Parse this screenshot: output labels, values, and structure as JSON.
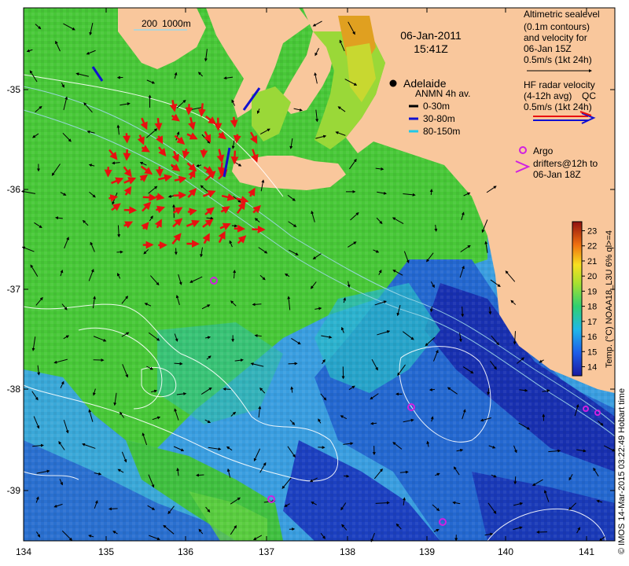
{
  "header": {
    "date": "06-Jan-2011",
    "time": "15:41Z"
  },
  "scale_bar": {
    "label_a": "200",
    "label_b": "1000m"
  },
  "places": {
    "adelaide": "Adelaide"
  },
  "legend_altimetry": {
    "line1": "Altimetric sealevel",
    "line2": "(0.1m contours)",
    "line3": "and velocity for",
    "line4": "06-Jan 15Z",
    "line5": "0.5m/s (1kt 24h)"
  },
  "legend_hf": {
    "line1": "HF radar velocity",
    "line2": "(4-12h avg)",
    "line2_tail": "QC",
    "line3": "0.5m/s (1kt 24h)"
  },
  "legend_anmn": {
    "title": "ANMN 4h av.",
    "entries": [
      {
        "label": "0-30m",
        "color": "#000000"
      },
      {
        "label": "30-80m",
        "color": "#1010d0"
      },
      {
        "label": "80-150m",
        "color": "#20c8e8"
      }
    ]
  },
  "legend_argo": {
    "line1": "Argo",
    "line2": "drifters@12h to",
    "line3": "06-Jan 18Z"
  },
  "colorbar": {
    "title": "Temp. (°C) NOAA18_L3U 6% ql>=4",
    "ticks": [
      "14",
      "15",
      "16",
      "17",
      "18",
      "19",
      "20",
      "21",
      "22",
      "23"
    ],
    "range": [
      13.4,
      23.6
    ]
  },
  "x_ticks": [
    "134",
    "135",
    "136",
    "137",
    "138",
    "139",
    "140",
    "141"
  ],
  "y_ticks": [
    "-35",
    "-36",
    "-37",
    "-38",
    "-39"
  ],
  "credit": "© IMOS 14-Mar-2015 03:22:49 Hobart time",
  "colors": {
    "land": "#f9c79c",
    "warm_water": "#44c830",
    "cool_water": "#2080e0",
    "deep_cool": "#1838b8",
    "hf_arrows": "#e81010",
    "argo": "#d020e0"
  }
}
